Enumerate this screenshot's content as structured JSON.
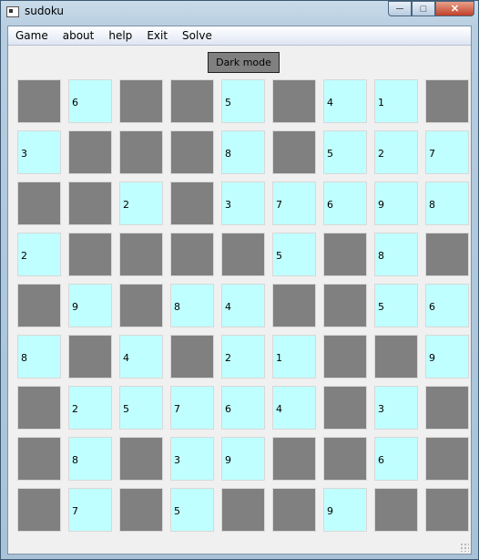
{
  "window": {
    "title": "sudoku",
    "controls": {
      "minimize": "─",
      "maximize": "□",
      "close": "✕"
    }
  },
  "menu": [
    "Game",
    "about",
    "help",
    "Exit",
    "Solve"
  ],
  "dark_mode_button": "Dark mode",
  "colors": {
    "blank_cell": "#808080",
    "filled_cell": "#c0ffff"
  },
  "board": [
    [
      "",
      "6",
      "",
      "",
      "5",
      "",
      "4",
      "1",
      ""
    ],
    [
      "3",
      "",
      "",
      "",
      "8",
      "",
      "5",
      "2",
      "7"
    ],
    [
      "",
      "",
      "2",
      "",
      "3",
      "7",
      "6",
      "9",
      "8"
    ],
    [
      "2",
      "",
      "",
      "",
      "",
      "5",
      "",
      "8",
      ""
    ],
    [
      "",
      "9",
      "",
      "8",
      "4",
      "",
      "",
      "5",
      "6"
    ],
    [
      "8",
      "",
      "4",
      "",
      "2",
      "1",
      "",
      "",
      "9"
    ],
    [
      "",
      "2",
      "5",
      "7",
      "6",
      "4",
      "",
      "3",
      ""
    ],
    [
      "",
      "8",
      "",
      "3",
      "9",
      "",
      "",
      "6",
      ""
    ],
    [
      "",
      "7",
      "",
      "5",
      "",
      "",
      "9",
      "",
      ""
    ]
  ],
  "filled_mask": [
    [
      0,
      1,
      0,
      0,
      1,
      0,
      1,
      1,
      0
    ],
    [
      1,
      0,
      0,
      0,
      1,
      0,
      1,
      1,
      1
    ],
    [
      0,
      0,
      1,
      0,
      1,
      1,
      1,
      1,
      1
    ],
    [
      1,
      0,
      0,
      0,
      0,
      1,
      0,
      1,
      0
    ],
    [
      0,
      1,
      0,
      1,
      1,
      0,
      0,
      1,
      1
    ],
    [
      1,
      0,
      1,
      0,
      1,
      1,
      0,
      0,
      1
    ],
    [
      0,
      1,
      1,
      1,
      1,
      1,
      0,
      1,
      0
    ],
    [
      0,
      1,
      0,
      1,
      1,
      0,
      0,
      1,
      0
    ],
    [
      0,
      1,
      0,
      1,
      0,
      0,
      1,
      0,
      0
    ]
  ]
}
